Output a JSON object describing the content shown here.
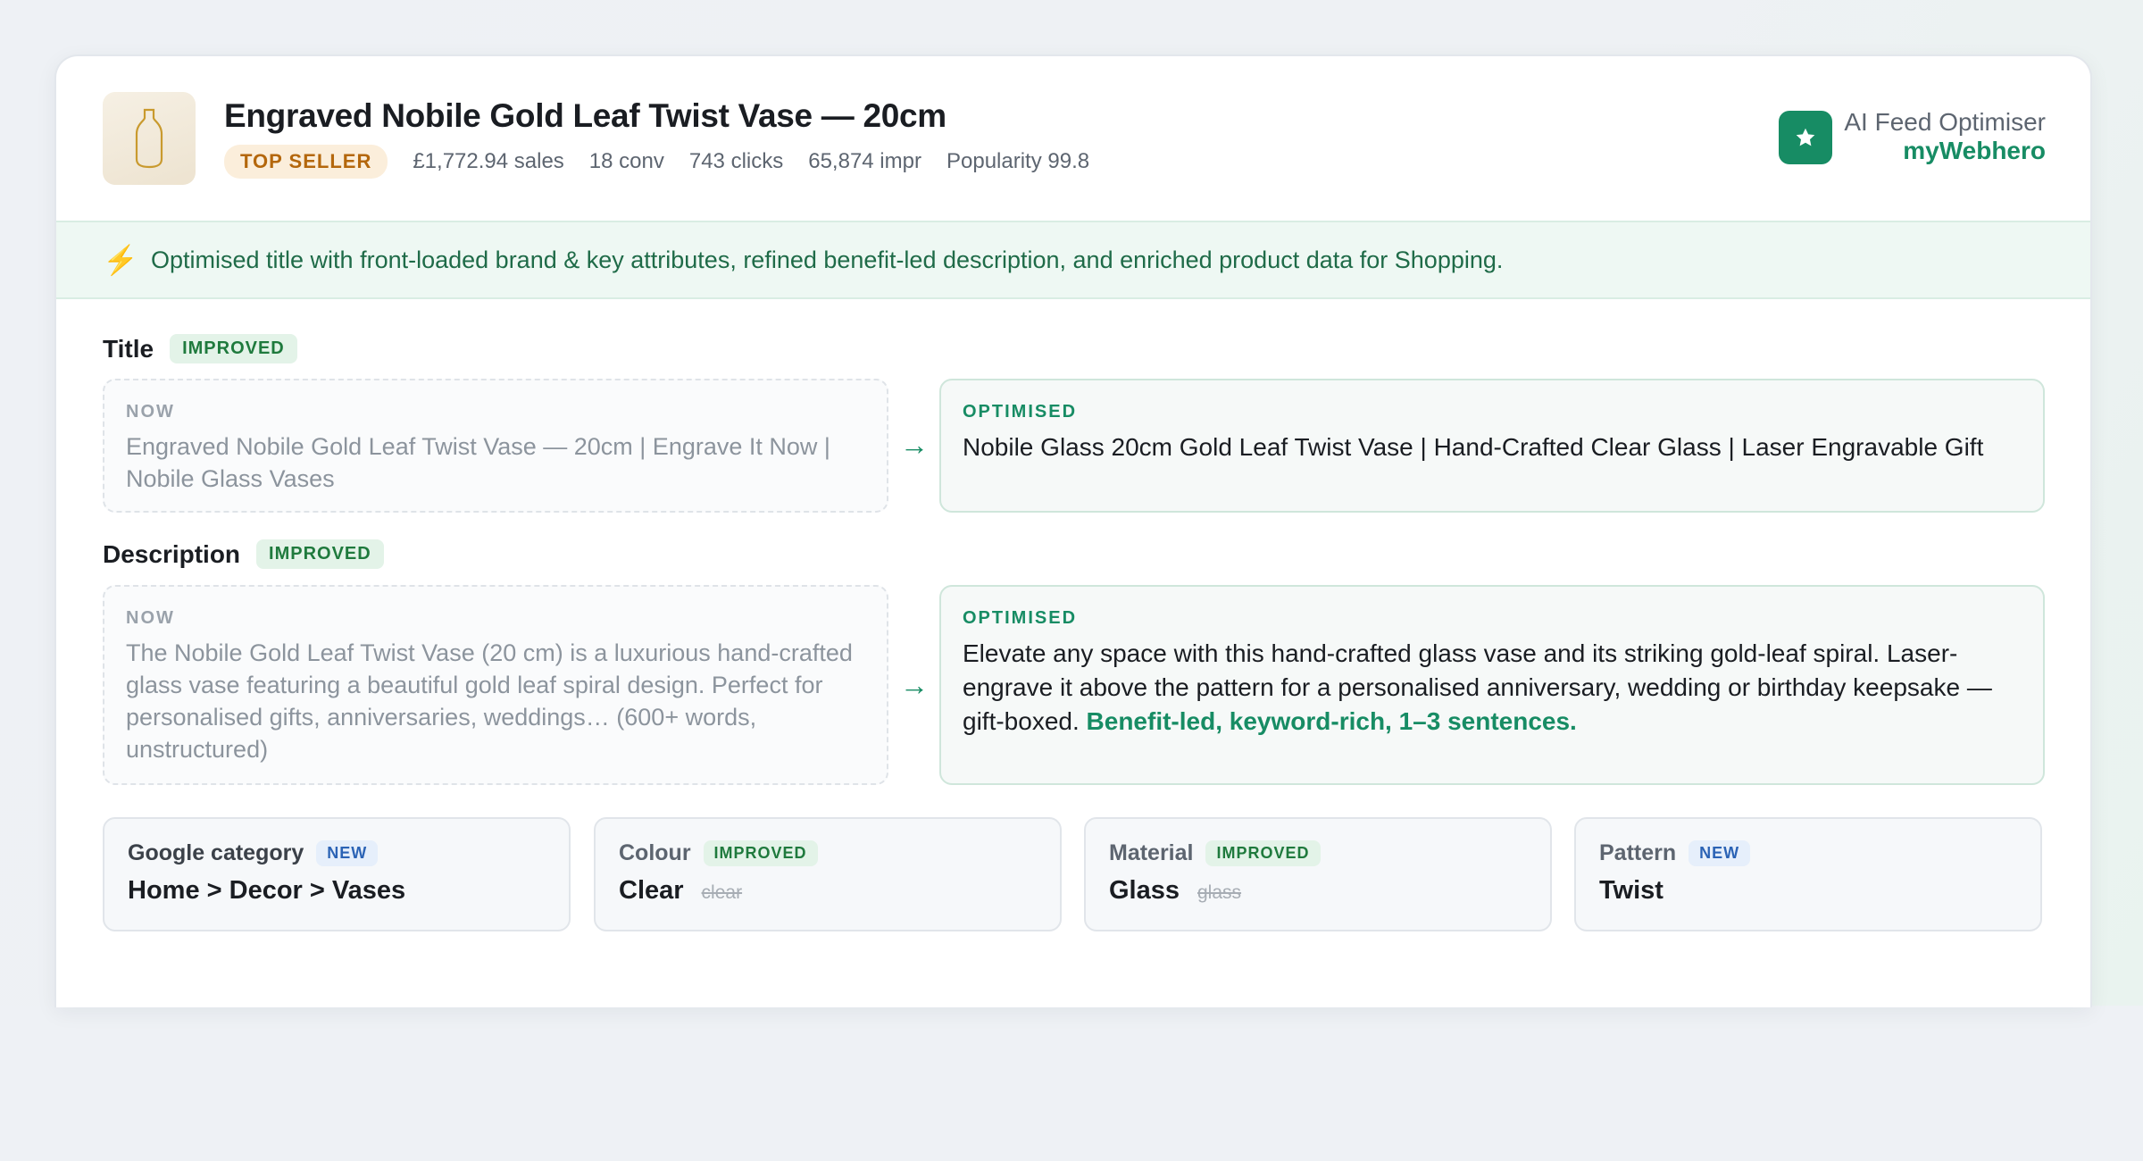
{
  "product": {
    "title": "Engraved Nobile Gold Leaf Twist Vase — 20cm",
    "badge": "TOP SELLER",
    "stats": [
      "£1,772.94 sales",
      "18 conv",
      "743 clicks",
      "65,874 impr",
      "Popularity 99.8"
    ]
  },
  "brand": {
    "subtitle": "AI Feed Optimiser",
    "name": "myWebhero",
    "icon": "star-icon",
    "color": "#178c64"
  },
  "summary": {
    "icon": "lightning-icon",
    "text": "Optimised title with front-loaded brand & key attributes, refined benefit-led description, and enriched product data for Shopping."
  },
  "title_section": {
    "label": "Title",
    "status": "IMPROVED",
    "now_label": "NOW",
    "now_text": "Engraved Nobile Gold Leaf Twist Vase — 20cm | Engrave It Now | Nobile Glass Vases",
    "optimised_label": "OPTIMISED",
    "optimised_text": "Nobile Glass 20cm Gold Leaf Twist Vase | Hand-Crafted Clear Glass | Laser Engravable Gift"
  },
  "description_section": {
    "label": "Description",
    "status": "IMPROVED",
    "now_label": "NOW",
    "now_text": "The Nobile Gold Leaf Twist Vase (20 cm) is a luxurious hand-crafted glass vase featuring a beautiful gold leaf spiral design. Perfect for personalised gifts, anniversaries, weddings… (600+ words, unstructured)",
    "optimised_label": "OPTIMISED",
    "optimised_text": "Elevate any space with this hand-crafted glass vase and its striking gold-leaf spiral. Laser-engrave it above the pattern for a personalised anniversary, wedding or birthday keepsake — gift-boxed.",
    "optimised_hint": "Benefit-led, keyword-rich, 1–3 sentences."
  },
  "arrow": "→",
  "attributes": [
    {
      "name": "Google category",
      "status": "NEW",
      "value": "Home > Decor > Vases",
      "old": ""
    },
    {
      "name": "Colour",
      "status": "IMPROVED",
      "value": "Clear",
      "old": "clear"
    },
    {
      "name": "Material",
      "status": "IMPROVED",
      "value": "Glass",
      "old": "glass"
    },
    {
      "name": "Pattern",
      "status": "NEW",
      "value": "Twist",
      "old": ""
    }
  ]
}
